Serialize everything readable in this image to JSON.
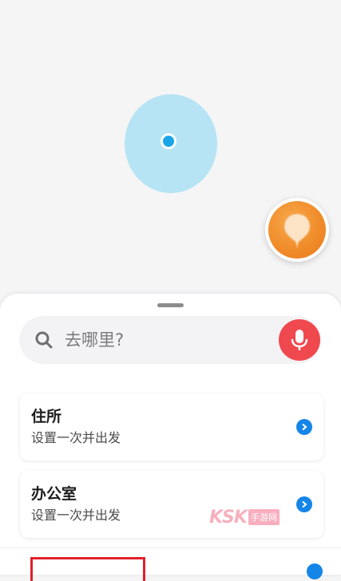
{
  "search": {
    "placeholder": "去哪里?"
  },
  "places": [
    {
      "title": "住所",
      "subtitle": "设置一次并出发"
    },
    {
      "title": "办公室",
      "subtitle": "设置一次并出发"
    }
  ],
  "watermark": {
    "brand": "KSK",
    "tag": "手游网"
  },
  "colors": {
    "accent": "#1585e8",
    "mic": "#f0484f",
    "fab": "#f08a28",
    "location": "#1aa5e8",
    "accuracy": "#b7e4f4"
  },
  "icons": [
    "search-icon",
    "microphone-icon",
    "chevron-right-icon",
    "location-dot-icon",
    "pin-icon"
  ]
}
